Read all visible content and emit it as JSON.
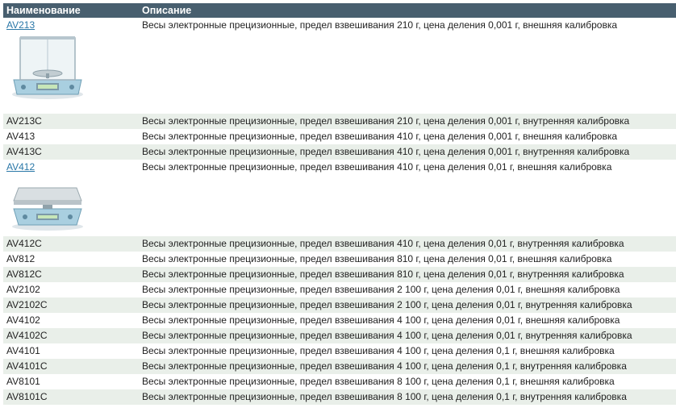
{
  "table": {
    "header": {
      "name": "Наименование",
      "description": "Описание"
    },
    "rows": [
      {
        "name": "AV213",
        "link": true,
        "image": "balance-with-draft-shield-image",
        "description": "Весы электронные прецизионные, предел взвешивания 210 г, цена деления 0,001 г, внешняя калибровка"
      },
      {
        "name": "AV213C",
        "description": "Весы электронные прецизионные, предел взвешивания 210 г, цена деления 0,001 г, внутренняя калибровка"
      },
      {
        "name": "AV413",
        "description": "Весы электронные прецизионные, предел взвешивания 410 г, цена деления 0,001 г, внешняя калибровка"
      },
      {
        "name": "AV413C",
        "description": "Весы электронные прецизионные, предел взвешивания 410 г, цена деления 0,001 г, внутренняя калибровка"
      },
      {
        "name": "AV412",
        "link": true,
        "image": "precision-balance-image",
        "description": "Весы электронные прецизионные, предел взвешивания 410 г, цена деления 0,01 г, внешняя калибровка"
      },
      {
        "name": "AV412C",
        "description": "Весы электронные прецизионные, предел взвешивания 410 г, цена деления 0,01 г, внутренняя калибровка"
      },
      {
        "name": "AV812",
        "description": "Весы электронные прецизионные, предел взвешивания 810 г, цена деления 0,01 г, внешняя калибровка"
      },
      {
        "name": "AV812C",
        "description": "Весы электронные прецизионные, предел взвешивания 810 г, цена деления 0,01 г, внутренняя калибровка"
      },
      {
        "name": "AV2102",
        "description": "Весы электронные прецизионные, предел взвешивания 2 100 г, цена деления 0,01 г, внешняя калибровка"
      },
      {
        "name": "AV2102C",
        "description": "Весы электронные прецизионные, предел взвешивания 2 100 г, цена деления 0,01 г, внутренняя калибровка"
      },
      {
        "name": "AV4102",
        "description": "Весы электронные прецизионные, предел взвешивания 4 100 г, цена деления 0,01 г, внешняя калибровка"
      },
      {
        "name": "AV4102C",
        "description": "Весы электронные прецизионные, предел взвешивания 4 100 г, цена деления 0,01 г, внутренняя калибровка"
      },
      {
        "name": "AV4101",
        "description": "Весы электронные прецизионные, предел взвешивания 4 100 г, цена деления 0,1 г, внешняя калибровка"
      },
      {
        "name": "AV4101C",
        "description": "Весы электронные прецизионные, предел взвешивания 4 100 г, цена деления 0,1 г, внутренняя калибровка"
      },
      {
        "name": "AV8101",
        "description": "Весы электронные прецизионные, предел взвешивания 8 100 г, цена деления 0,1 г, внешняя калибровка"
      },
      {
        "name": "AV8101C",
        "description": "Весы электронные прецизионные, предел взвешивания 8 100 г, цена деления 0,1 г, внутренняя калибровка"
      }
    ]
  },
  "colors": {
    "header_bg": "#485f6f",
    "alt_row_bg": "#e9efe9",
    "link": "#2b78a8"
  }
}
